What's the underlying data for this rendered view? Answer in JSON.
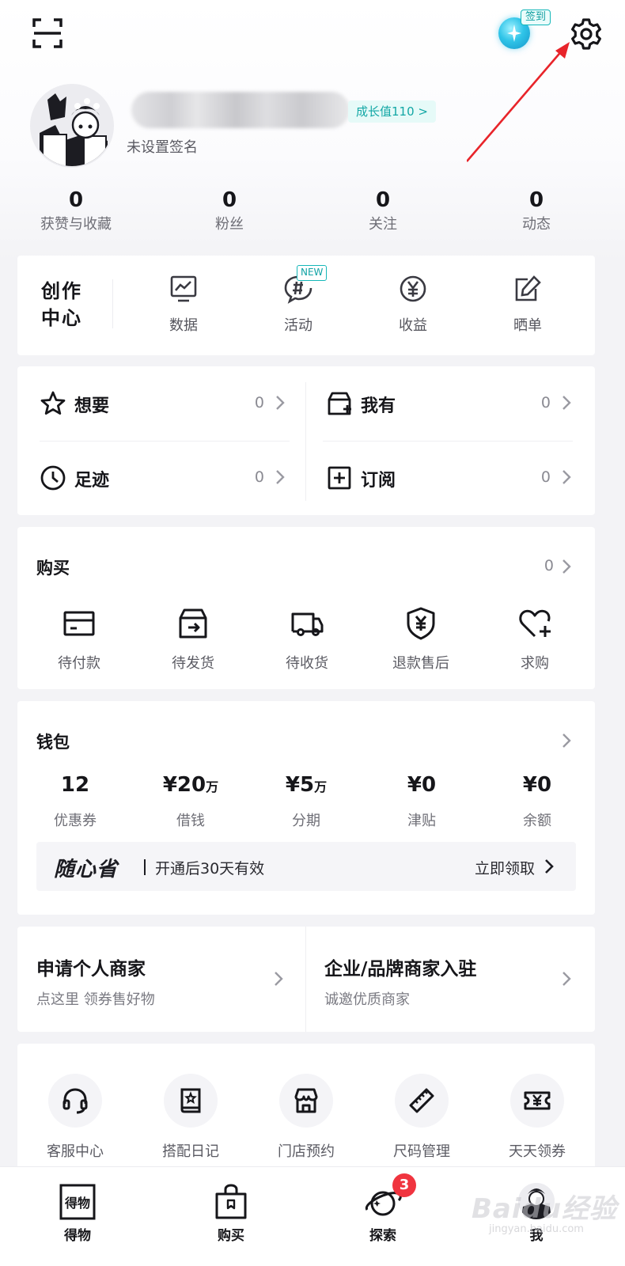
{
  "header": {
    "scan_icon": "scan-icon",
    "sign_in_label": "签到",
    "settings_icon": "gear-icon"
  },
  "profile": {
    "growth_value": "成长值110 >",
    "signature": "未设置签名"
  },
  "stats": [
    {
      "value": "0",
      "label": "获赞与收藏"
    },
    {
      "value": "0",
      "label": "粉丝"
    },
    {
      "value": "0",
      "label": "关注"
    },
    {
      "value": "0",
      "label": "动态"
    }
  ],
  "creator": {
    "title": "创作中心",
    "items": [
      {
        "label": "数据",
        "icon": "chart-icon"
      },
      {
        "label": "活动",
        "icon": "activity-icon",
        "badge": "NEW"
      },
      {
        "label": "收益",
        "icon": "yuan-icon"
      },
      {
        "label": "晒单",
        "icon": "edit-icon"
      }
    ]
  },
  "quick": [
    {
      "label": "想要",
      "count": "0",
      "icon": "star-icon"
    },
    {
      "label": "我有",
      "count": "0",
      "icon": "box-icon"
    },
    {
      "label": "足迹",
      "count": "0",
      "icon": "clock-icon"
    },
    {
      "label": "订阅",
      "count": "0",
      "icon": "plus-square-icon"
    }
  ],
  "purchase": {
    "title": "购买",
    "count": "0",
    "items": [
      {
        "label": "待付款",
        "icon": "card-icon"
      },
      {
        "label": "待发货",
        "icon": "package-icon"
      },
      {
        "label": "待收货",
        "icon": "truck-icon"
      },
      {
        "label": "退款售后",
        "icon": "shield-yuan-icon"
      },
      {
        "label": "求购",
        "icon": "heart-plus-icon"
      }
    ]
  },
  "wallet": {
    "title": "钱包",
    "items": [
      {
        "value": "12",
        "unit": "",
        "label": "优惠券"
      },
      {
        "value": "¥20",
        "unit": "万",
        "label": "借钱"
      },
      {
        "value": "¥5",
        "unit": "万",
        "label": "分期"
      },
      {
        "value": "¥0",
        "unit": "",
        "label": "津贴"
      },
      {
        "value": "¥0",
        "unit": "",
        "label": "余额"
      }
    ],
    "promo": {
      "brand": "随心省",
      "text": "开通后30天有效",
      "cta": "立即领取"
    }
  },
  "merchant": [
    {
      "title": "申请个人商家",
      "subtitle": "点这里 领券售好物"
    },
    {
      "title": "企业/品牌商家入驻",
      "subtitle": "诚邀优质商家"
    }
  ],
  "tools": [
    {
      "label": "客服中心",
      "icon": "headset-icon"
    },
    {
      "label": "搭配日记",
      "icon": "book-icon"
    },
    {
      "label": "门店预约",
      "icon": "store-icon"
    },
    {
      "label": "尺码管理",
      "icon": "ruler-icon"
    },
    {
      "label": "天天领券",
      "icon": "ticket-icon"
    }
  ],
  "tabbar": [
    {
      "label": "得物",
      "icon": "dewu-logo-icon",
      "logo_text": "得物"
    },
    {
      "label": "购买",
      "icon": "shopping-bag-icon"
    },
    {
      "label": "探索",
      "icon": "planet-icon",
      "badge": "3"
    },
    {
      "label": "我",
      "icon": "avatar-icon"
    }
  ],
  "watermark": {
    "text": "Baidu经验",
    "sub": "jingyan.baidu.com"
  }
}
